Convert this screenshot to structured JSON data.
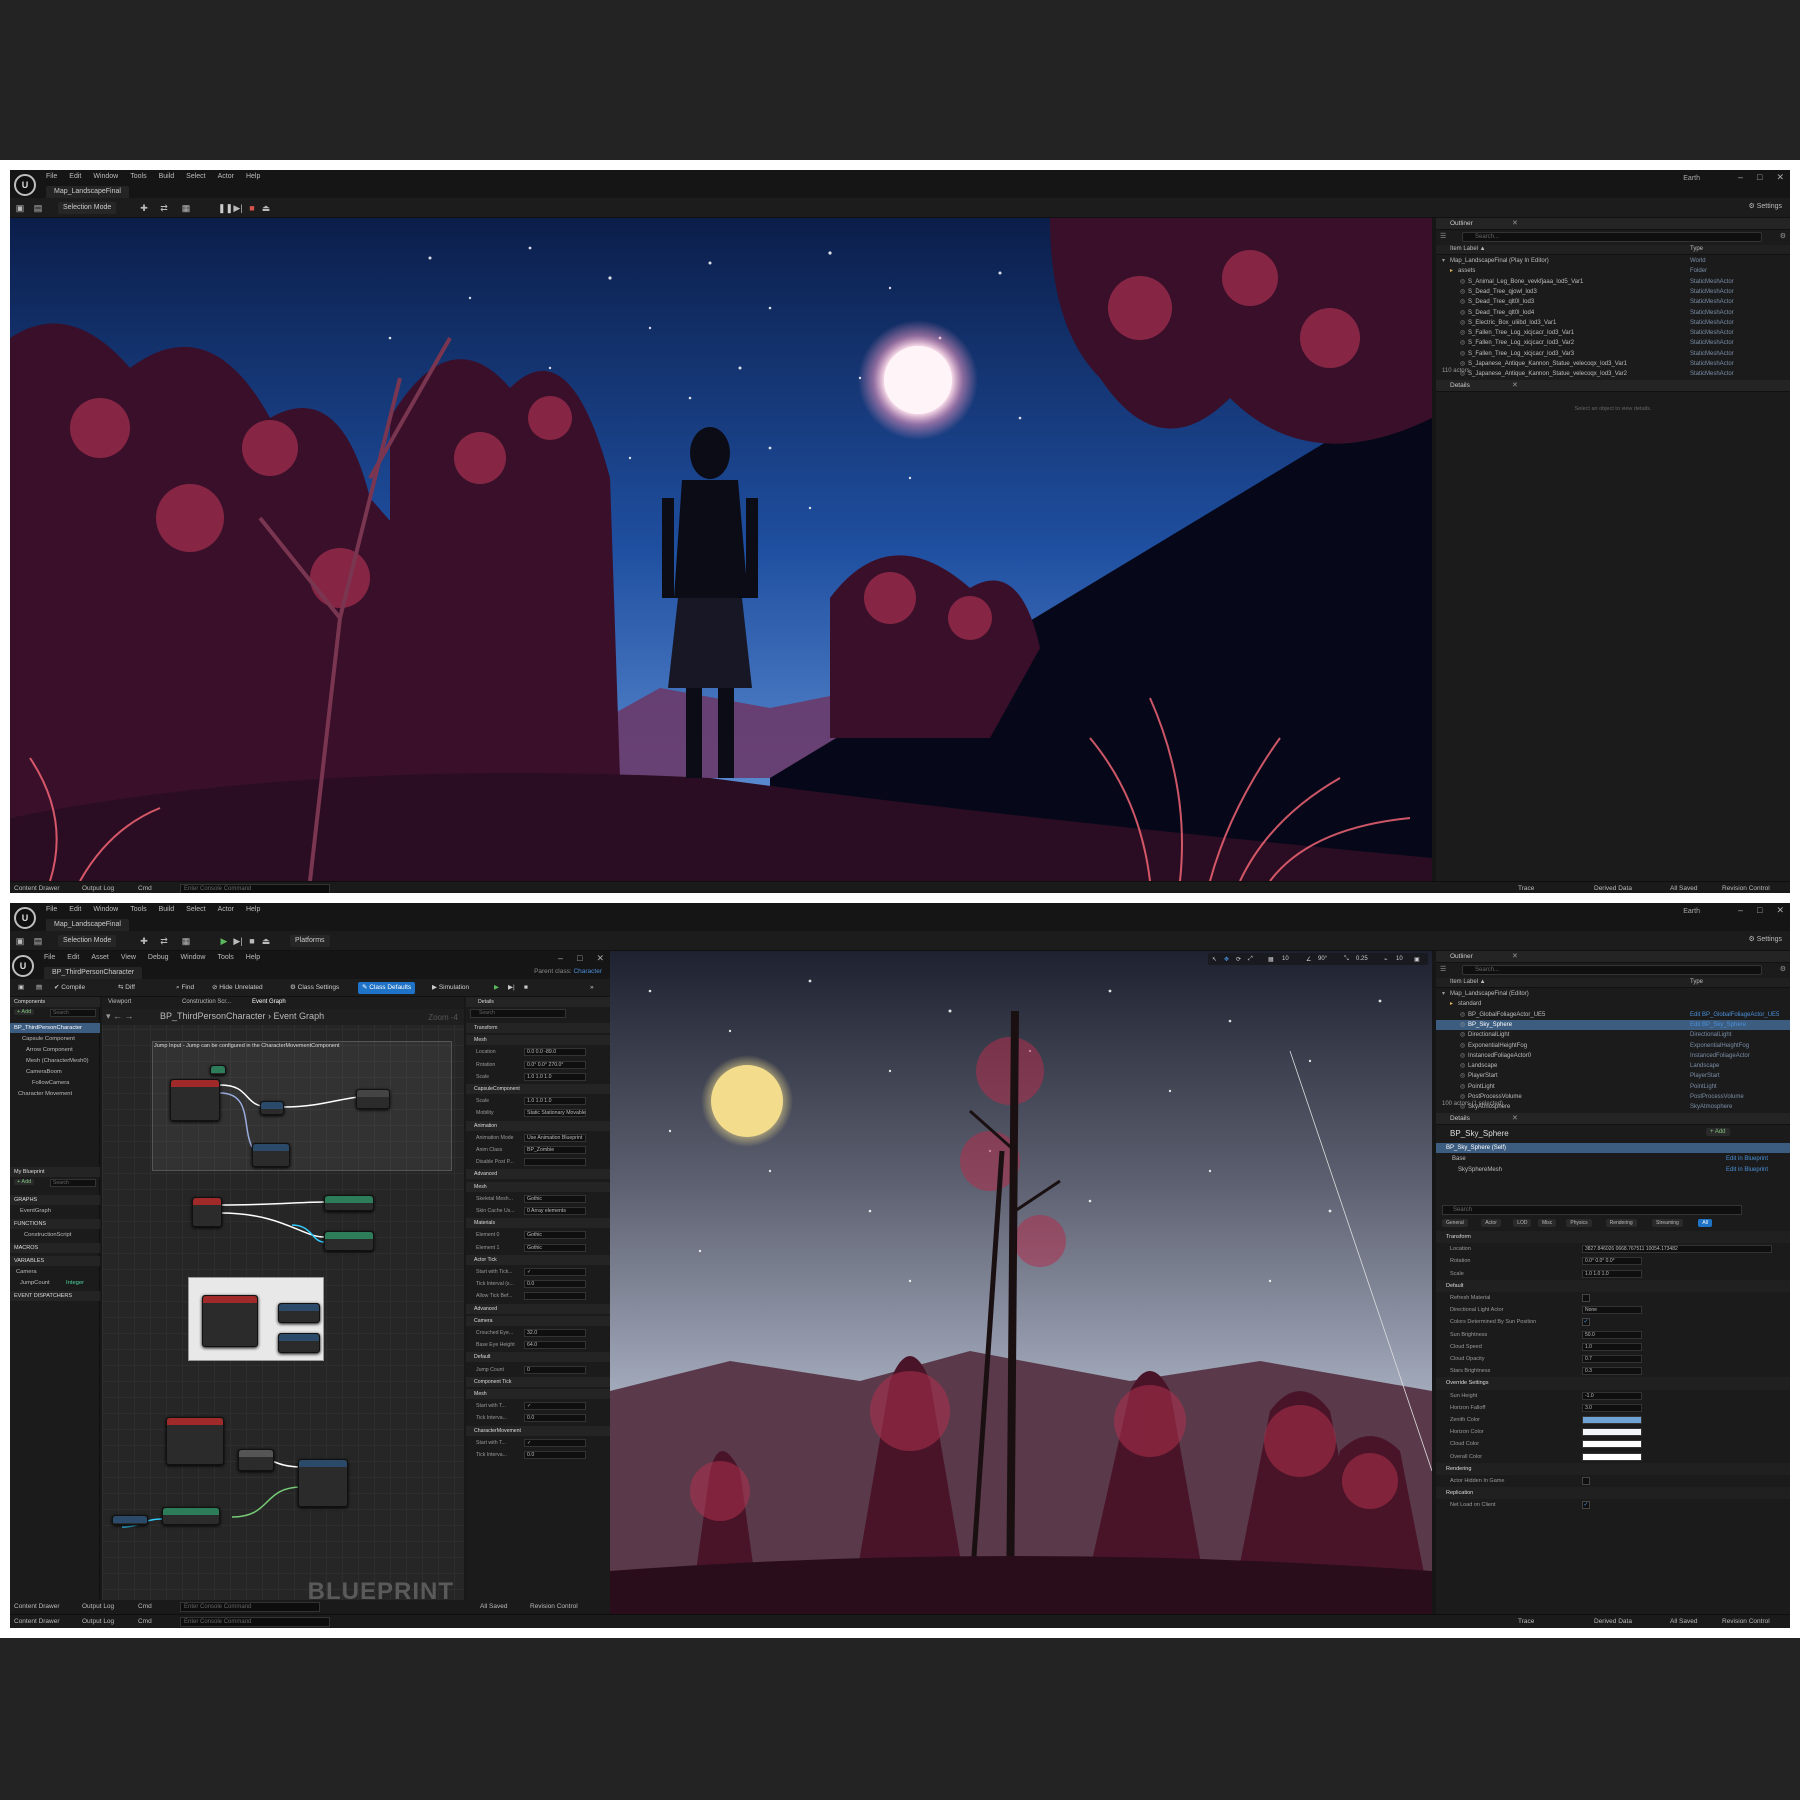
{
  "menu": [
    "File",
    "Edit",
    "Window",
    "Tools",
    "Build",
    "Select",
    "Actor",
    "Help"
  ],
  "map_tab": "Map_LandscapeFinal",
  "project": "Earth",
  "toolbar": {
    "selection_mode": "Selection Mode",
    "platforms": "Platforms",
    "settings": "Settings"
  },
  "status": {
    "content_drawer": "Content Drawer",
    "output_log": "Output Log",
    "cmd": "Cmd",
    "console_placeholder": "Enter Console Command",
    "trace": "Trace",
    "derived_data": "Derived Data",
    "all_saved": "All Saved",
    "revision_control": "Revision Control"
  },
  "outliner1": {
    "tab": "Outliner",
    "search_placeholder": "Search...",
    "col_label": "Item Label ▲",
    "col_type": "Type",
    "rows": [
      {
        "label": "Map_LandscapeFinal (Play In Editor)",
        "type": "World"
      },
      {
        "label": "assets",
        "type": "Folder"
      },
      {
        "label": "S_Animal_Leg_Bone_vevkfjaaa_lod5_Var1",
        "type": "StaticMeshActor"
      },
      {
        "label": "S_Dead_Tree_qjowl_lod3",
        "type": "StaticMeshActor"
      },
      {
        "label": "S_Dead_Tree_qlt0l_lod3",
        "type": "StaticMeshActor"
      },
      {
        "label": "S_Dead_Tree_qlt0l_lod4",
        "type": "StaticMeshActor"
      },
      {
        "label": "S_Electric_Box_uliibd_lod3_Var1",
        "type": "StaticMeshActor"
      },
      {
        "label": "S_Fallen_Tree_Log_xicjcacr_lod3_Var1",
        "type": "StaticMeshActor"
      },
      {
        "label": "S_Fallen_Tree_Log_xicjcacr_lod3_Var2",
        "type": "StaticMeshActor"
      },
      {
        "label": "S_Fallen_Tree_Log_xicjcacr_lod3_Var3",
        "type": "StaticMeshActor"
      },
      {
        "label": "S_Japanese_Antique_Kannon_Statue_velecoqx_lod3_Var1",
        "type": "StaticMeshActor"
      },
      {
        "label": "S_Japanese_Antique_Kannon_Statue_velecoqx_lod3_Var2",
        "type": "StaticMeshActor"
      }
    ],
    "count": "110 actors"
  },
  "details1": {
    "tab": "Details",
    "empty": "Select an object to view details."
  },
  "bp": {
    "tab": "BP_ThirdPersonCharacter",
    "menu": [
      "File",
      "Edit",
      "Asset",
      "View",
      "Debug",
      "Window",
      "Tools",
      "Help"
    ],
    "parent_class": "Parent class:",
    "parent_value": "Character",
    "toolbar": {
      "compile": "Compile",
      "diff": "Diff",
      "find": "Find",
      "hide_unrelated": "Hide Unrelated",
      "class_settings": "Class Settings",
      "class_defaults": "Class Defaults",
      "simulation": "Simulation"
    },
    "components_tab": "Components",
    "add": "+ Add",
    "search": "Search",
    "components": [
      "BP_ThirdPersonCharacter",
      "Capsule Component",
      "Arrow Component",
      "Mesh (CharacterMesh0)",
      "CameraBoom",
      "FollowCamera",
      "Character Movement"
    ],
    "myblueprint_tab": "My Blueprint",
    "sections": {
      "graphs": "GRAPHS",
      "event_graph": "EventGraph",
      "functions": "FUNCTIONS",
      "construction_script": "ConstructionScript",
      "macros": "MACROS",
      "variables": "VARIABLES",
      "camera": "Camera",
      "jump_count": "JumpCount",
      "jump_count_type": "Integer",
      "dispatchers": "EVENT DISPATCHERS"
    },
    "graph_tabs": [
      "Viewport",
      "Construction Scr...",
      "Event Graph"
    ],
    "breadcrumb": "BP_ThirdPersonCharacter  ›  Event Graph",
    "zoom": "Zoom -4",
    "comment": "Jump Input - Jump can be configured in the CharacterMovementComponent",
    "watermark": "BLUEPRINT",
    "details_tab": "Details",
    "details_rows": [
      {
        "label": "Transform",
        "sec": true
      },
      {
        "label": "Mesh",
        "sec": true
      },
      {
        "label": "Location",
        "value": "0.0   0.0   -89.0"
      },
      {
        "label": "Rotation",
        "value": "0.0°  0.0°  270.0°"
      },
      {
        "label": "Scale",
        "value": "1.0   1.0   1.0"
      },
      {
        "label": "CapsuleComponent",
        "sec": true
      },
      {
        "label": "Scale",
        "value": "1.0   1.0   1.0"
      },
      {
        "label": "Mobility",
        "value": "Static  Stationary  Movable"
      },
      {
        "label": "Animation",
        "sec": true
      },
      {
        "label": "Animation Mode",
        "value": "Use Animation Blueprint"
      },
      {
        "label": "Anim Class",
        "value": "BP_Zombie"
      },
      {
        "label": "Disable Post P...",
        "value": ""
      },
      {
        "label": "Advanced",
        "sec": true
      },
      {
        "label": "Mesh",
        "sec": true
      },
      {
        "label": "Skeletal Mesh...",
        "value": "Gothic"
      },
      {
        "label": "Skin Cache Us...",
        "value": "0 Array elements"
      },
      {
        "label": "Materials",
        "sec": true
      },
      {
        "label": "Element 0",
        "value": "Gothic"
      },
      {
        "label": "Element 1",
        "value": "Gothic"
      },
      {
        "label": "Actor Tick",
        "sec": true
      },
      {
        "label": "Start with Tick...",
        "value": "✓"
      },
      {
        "label": "Tick Interval (s...",
        "value": "0.0"
      },
      {
        "label": "Allow Tick Bef...",
        "value": ""
      },
      {
        "label": "Advanced",
        "sec": true
      },
      {
        "label": "Camera",
        "sec": true
      },
      {
        "label": "Crouched Eye...",
        "value": "32.0"
      },
      {
        "label": "Base Eye Height",
        "value": "64.0"
      },
      {
        "label": "Default",
        "sec": true
      },
      {
        "label": "Jump Count",
        "value": "0"
      },
      {
        "label": "Component Tick",
        "sec": true
      },
      {
        "label": "Mesh",
        "sec": true
      },
      {
        "label": "Start with T...",
        "value": "✓"
      },
      {
        "label": "Tick Interva...",
        "value": "0.0"
      },
      {
        "label": "CharacterMovement",
        "sec": true
      },
      {
        "label": "Start with T...",
        "value": "✓"
      },
      {
        "label": "Tick Interva...",
        "value": "0.0"
      }
    ]
  },
  "outliner2": {
    "tab": "Outliner",
    "search_placeholder": "Search...",
    "col_label": "Item Label ▲",
    "col_type": "Type",
    "rows": [
      {
        "label": "Map_LandscapeFinal (Editor)",
        "type": ""
      },
      {
        "label": "standard",
        "type": ""
      },
      {
        "label": "BP_GlobalFoliageActor_UE5",
        "type": "Edit BP_GlobalFoliageActor_UE5",
        "edit": true
      },
      {
        "label": "BP_Sky_Sphere",
        "type": "Edit BP_Sky_Sphere",
        "edit": true,
        "sel": true
      },
      {
        "label": "DirectionalLight",
        "type": "DirectionalLight"
      },
      {
        "label": "ExponentialHeightFog",
        "type": "ExponentialHeightFog"
      },
      {
        "label": "InstancedFoliageActor0",
        "type": "InstancedFoliageActor"
      },
      {
        "label": "Landscape",
        "type": "Landscape"
      },
      {
        "label": "PlayerStart",
        "type": "PlayerStart"
      },
      {
        "label": "PointLight",
        "type": "PointLight"
      },
      {
        "label": "PostProcessVolume",
        "type": "PostProcessVolume"
      },
      {
        "label": "SkyAtmosphere",
        "type": "SkyAtmosphere"
      }
    ],
    "count": "100 actors (1 selected)"
  },
  "details2": {
    "tab": "Details",
    "object": "BP_Sky_Sphere",
    "add": "+ Add",
    "tree": [
      {
        "label": "BP_Sky_Sphere (Self)",
        "edit": ""
      },
      {
        "label": "Base",
        "edit": "Edit in Blueprint"
      },
      {
        "label": "SkySphereMesh",
        "edit": "Edit in Blueprint"
      }
    ],
    "search_placeholder": "Search",
    "categories": [
      "General",
      "Actor",
      "LOD",
      "Misc",
      "Physics",
      "Rendering",
      "Streaming",
      "All"
    ],
    "props": [
      {
        "label": "Transform",
        "sec": true
      },
      {
        "label": "Location",
        "value": "3827.846026   0668.767511   10054.173482"
      },
      {
        "label": "Rotation",
        "value": "0.0°   0.0°   0.0°"
      },
      {
        "label": "Scale",
        "value": "1.0   1.0   1.0"
      },
      {
        "label": "Default",
        "sec": true
      },
      {
        "label": "Refresh Material",
        "check": ""
      },
      {
        "label": "Directional Light Actor",
        "value": "None"
      },
      {
        "label": "Colors Determined By Sun Position",
        "check": "✓"
      },
      {
        "label": "Sun Brightness",
        "value": "50.0"
      },
      {
        "label": "Cloud Speed",
        "value": "1.0"
      },
      {
        "label": "Cloud Opacity",
        "value": "0.7"
      },
      {
        "label": "Stars Brightness",
        "value": "0.3"
      },
      {
        "label": "Override Settings",
        "sec": true
      },
      {
        "label": "Sun Height",
        "value": "-1.0"
      },
      {
        "label": "Horizon Falloff",
        "value": "3.0"
      },
      {
        "label": "Zenith Color",
        "swatch": "#6fa3d6"
      },
      {
        "label": "Horizon Color",
        "swatch": "#f2f6fb"
      },
      {
        "label": "Cloud Color",
        "swatch": "#ffffff"
      },
      {
        "label": "Overall Color",
        "swatch": "#ffffff"
      },
      {
        "label": "Rendering",
        "sec": true
      },
      {
        "label": "Actor Hidden In Game",
        "check": ""
      },
      {
        "label": "Replication",
        "sec": true
      },
      {
        "label": "Net Load on Client",
        "check": "✓"
      }
    ]
  },
  "viewport2": {
    "fov": "90°",
    "scale": "0.25",
    "grid": "10",
    "cam": "10"
  }
}
